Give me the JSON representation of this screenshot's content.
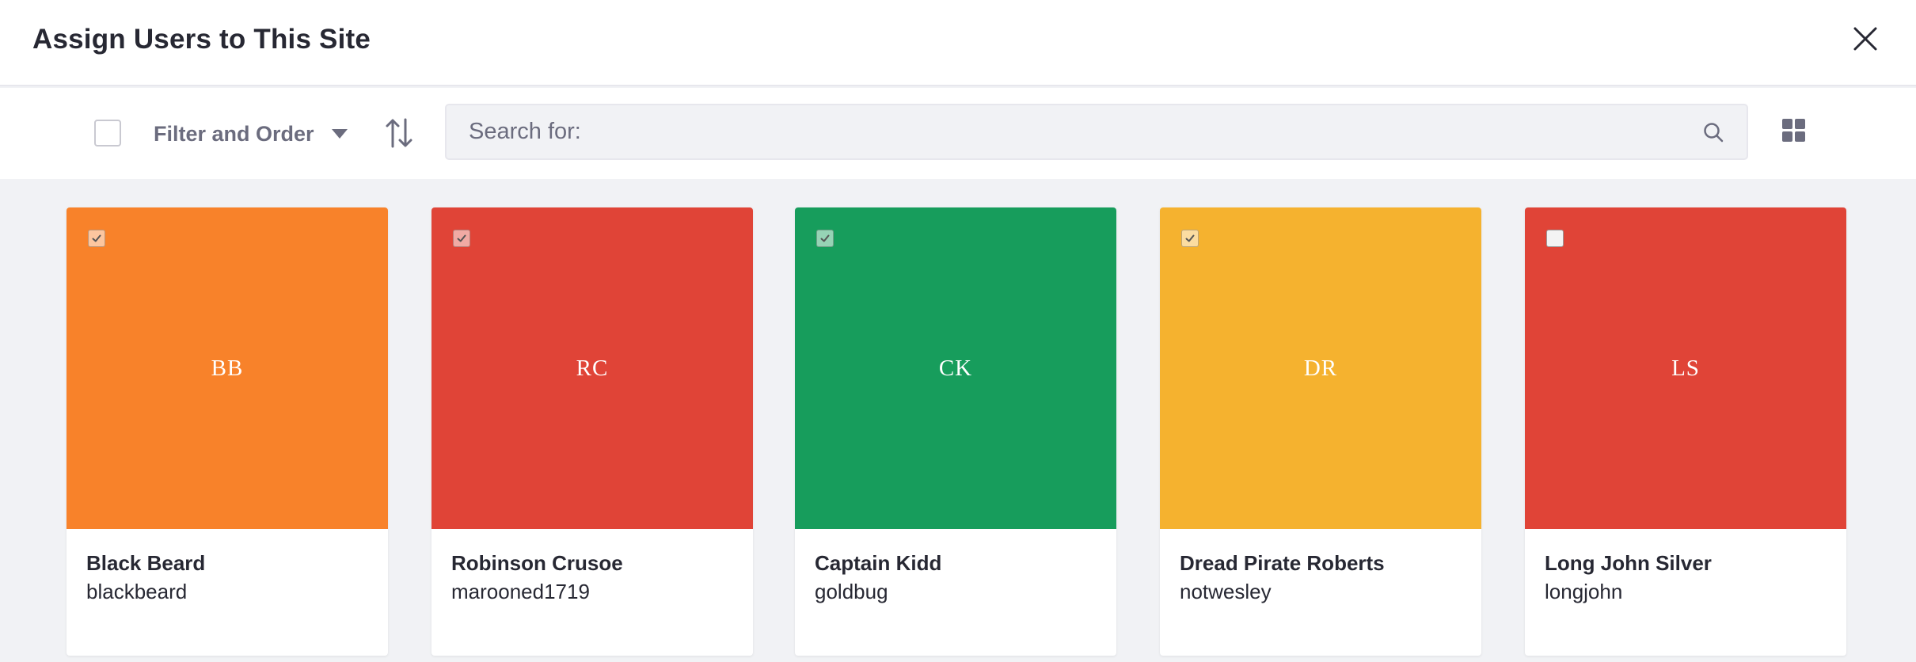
{
  "modal": {
    "title": "Assign Users to This Site",
    "close_icon": "close-icon"
  },
  "toolbar": {
    "filter_label": "Filter and Order",
    "sort_icon": "sort-arrows-icon",
    "search_placeholder": "Search for:",
    "search_value": "",
    "search_icon": "search-icon",
    "view_icon": "grid-view-icon"
  },
  "colors": {
    "orange": "#f8822a",
    "red": "#e04437",
    "green": "#179d5c",
    "yellow": "#f5b22f"
  },
  "users": [
    {
      "initials": "BB",
      "name": "Black Beard",
      "username": "blackbeard",
      "color": "#f8822a",
      "checked": true
    },
    {
      "initials": "RC",
      "name": "Robinson Crusoe",
      "username": "marooned1719",
      "color": "#e04437",
      "checked": true
    },
    {
      "initials": "CK",
      "name": "Captain Kidd",
      "username": "goldbug",
      "color": "#179d5c",
      "checked": true
    },
    {
      "initials": "DR",
      "name": "Dread Pirate Roberts",
      "username": "notwesley",
      "color": "#f5b22f",
      "checked": true
    },
    {
      "initials": "LS",
      "name": "Long John Silver",
      "username": "longjohn",
      "color": "#e04437",
      "checked": false
    }
  ]
}
